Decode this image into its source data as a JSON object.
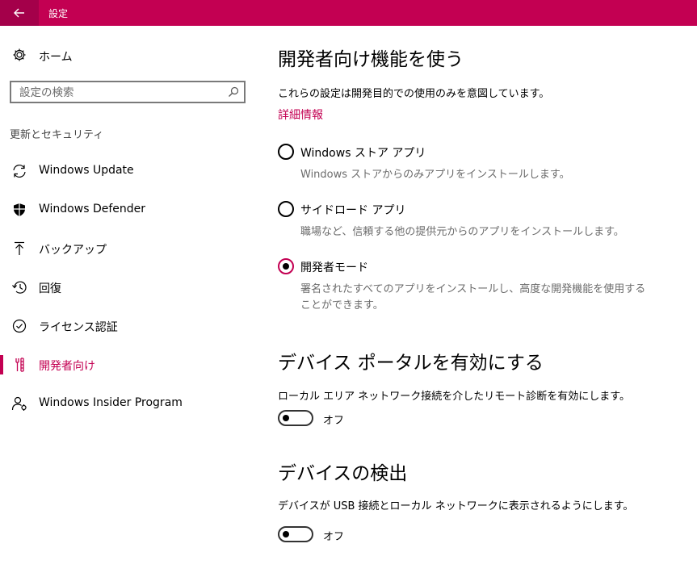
{
  "window": {
    "title": "設定"
  },
  "sidebar": {
    "home_label": "ホーム",
    "search_placeholder": "設定の検索",
    "section_header": "更新とセキュリティ",
    "items": [
      {
        "label": "Windows Update",
        "icon": "sync-icon"
      },
      {
        "label": "Windows Defender",
        "icon": "shield-icon"
      },
      {
        "label": "バックアップ",
        "icon": "upload-arrow-icon"
      },
      {
        "label": "回復",
        "icon": "history-icon"
      },
      {
        "label": "ライセンス認証",
        "icon": "check-circle-icon"
      },
      {
        "label": "開発者向け",
        "icon": "developer-tools-icon",
        "active": true
      },
      {
        "label": "Windows Insider Program",
        "icon": "person-badge-icon"
      }
    ]
  },
  "main": {
    "dev_features": {
      "heading": "開発者向け機能を使う",
      "description": "これらの設定は開発目的での使用のみを意図しています。",
      "link": "詳細情報",
      "options": [
        {
          "label": "Windows ストア アプリ",
          "description": "Windows ストアからのみアプリをインストールします。",
          "selected": false
        },
        {
          "label": "サイドロード アプリ",
          "description": "職場など、信頼する他の提供元からのアプリをインストールします。",
          "selected": false
        },
        {
          "label": "開発者モード",
          "description": "署名されたすべてのアプリをインストールし、高度な開発機能を使用することができます。",
          "selected": true
        }
      ]
    },
    "device_portal": {
      "heading": "デバイス ポータルを有効にする",
      "description": "ローカル エリア ネットワーク接続を介したリモート診断を有効にします。",
      "toggle_state": "オフ"
    },
    "device_discovery": {
      "heading": "デバイスの検出",
      "description": "デバイスが USB 接続とローカル ネットワークに表示されるようにします。",
      "toggle_state": "オフ"
    }
  },
  "colors": {
    "accent": "#c30052",
    "accent_dark": "#a4004a"
  }
}
